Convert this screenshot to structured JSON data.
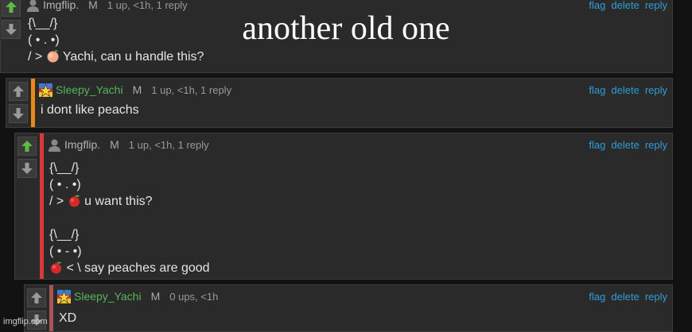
{
  "overlay": {
    "title": "another old one",
    "watermark": "imgflip.com"
  },
  "actions": {
    "flag": "flag",
    "delete": "delete",
    "reply": "reply"
  },
  "comments": [
    {
      "user": "Imgflip.",
      "mod": "M",
      "stats": "1 up, <1h, 1 reply",
      "lines": [
        "{\\__/}",
        "( • . •)",
        "/ > ",
        "Yachi, can u handle this?"
      ],
      "emoji": "peach",
      "bar_color": ""
    },
    {
      "user": "Sleepy_Yachi",
      "mod": "M",
      "stats": "1 up, <1h, 1 reply",
      "lines": [
        "i dont like peachs"
      ],
      "bar_color": "#e8891a"
    },
    {
      "user": "Imgflip.",
      "mod": "M",
      "stats": "1 up, <1h, 1 reply",
      "lines": [
        "{\\__/}",
        "( • . •)",
        "/ > ",
        "u want this?",
        "",
        "{\\__/}",
        "( • - •)",
        "< \\ say peaches are good"
      ],
      "emoji": "apple",
      "bar_color": "#d63a3a"
    },
    {
      "user": "Sleepy_Yachi",
      "mod": "M",
      "stats": "0 ups, <1h",
      "lines": [
        "XD"
      ],
      "bar_color": "#a85454"
    }
  ]
}
